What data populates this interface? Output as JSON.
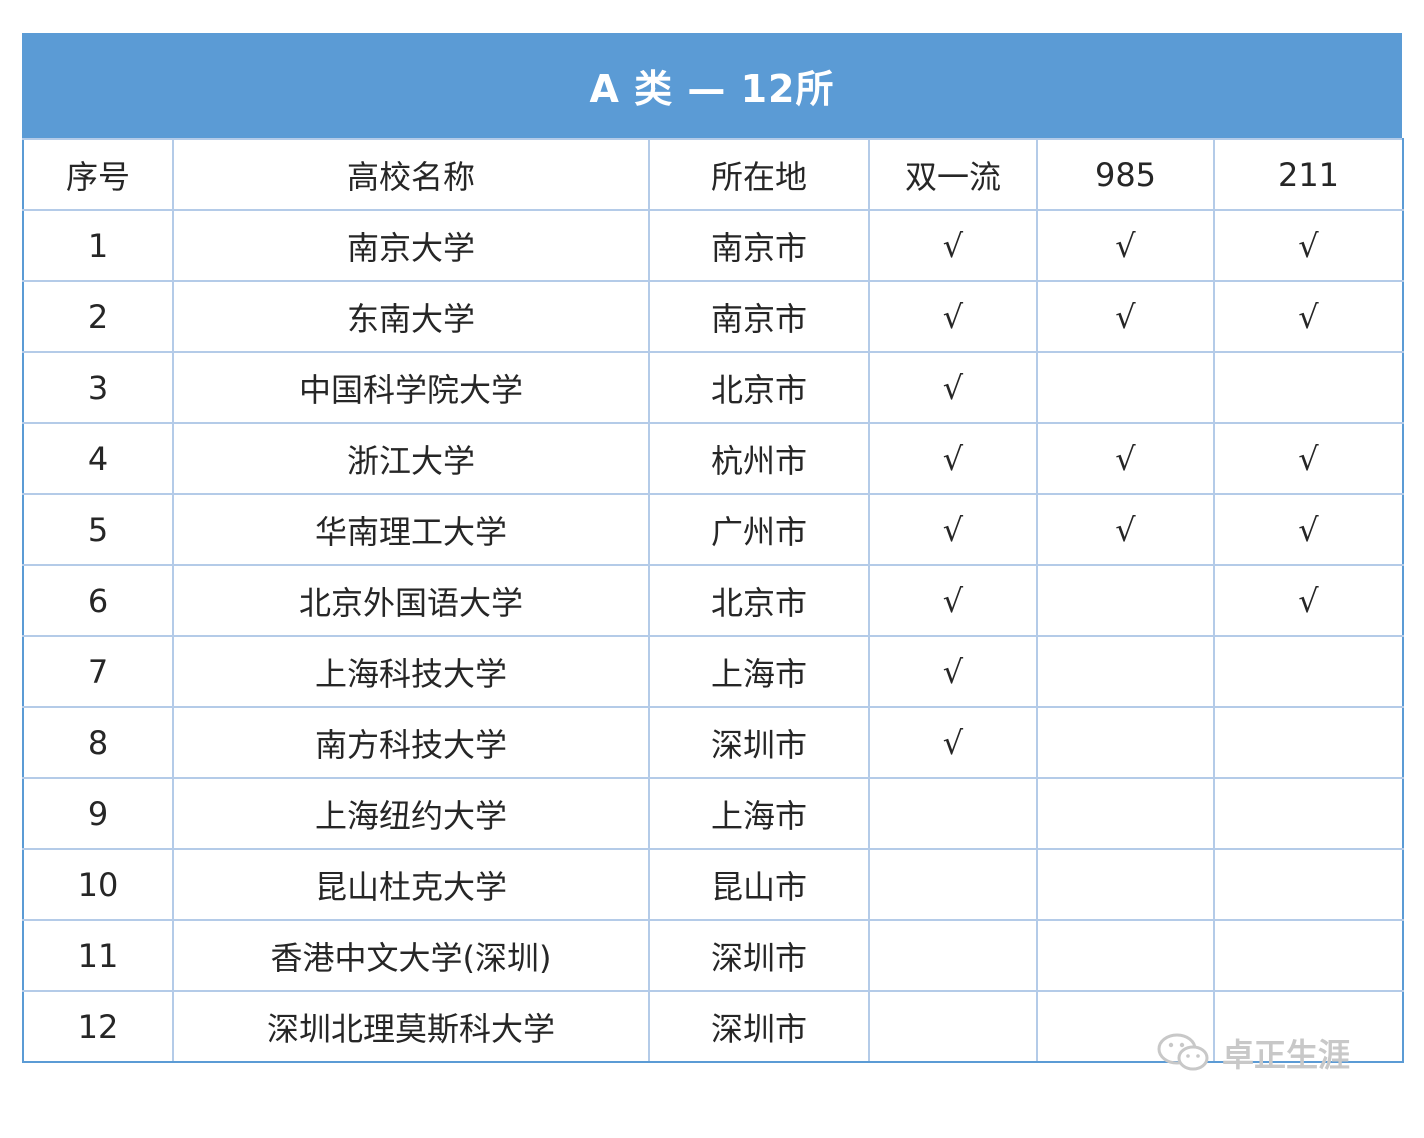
{
  "title": "A 类 — 12所",
  "columns": [
    "序号",
    "高校名称",
    "所在地",
    "双一流",
    "985",
    "211"
  ],
  "rows": [
    {
      "no": "1",
      "name": "南京大学",
      "city": "南京市",
      "dual": "√",
      "c985": "√",
      "c211": "√"
    },
    {
      "no": "2",
      "name": "东南大学",
      "city": "南京市",
      "dual": "√",
      "c985": "√",
      "c211": "√"
    },
    {
      "no": "3",
      "name": "中国科学院大学",
      "city": "北京市",
      "dual": "√",
      "c985": "",
      "c211": ""
    },
    {
      "no": "4",
      "name": "浙江大学",
      "city": "杭州市",
      "dual": "√",
      "c985": "√",
      "c211": "√"
    },
    {
      "no": "5",
      "name": "华南理工大学",
      "city": "广州市",
      "dual": "√",
      "c985": "√",
      "c211": "√"
    },
    {
      "no": "6",
      "name": "北京外国语大学",
      "city": "北京市",
      "dual": "√",
      "c985": "",
      "c211": "√"
    },
    {
      "no": "7",
      "name": "上海科技大学",
      "city": "上海市",
      "dual": "√",
      "c985": "",
      "c211": ""
    },
    {
      "no": "8",
      "name": "南方科技大学",
      "city": "深圳市",
      "dual": "√",
      "c985": "",
      "c211": ""
    },
    {
      "no": "9",
      "name": "上海纽约大学",
      "city": "上海市",
      "dual": "",
      "c985": "",
      "c211": ""
    },
    {
      "no": "10",
      "name": "昆山杜克大学",
      "city": "昆山市",
      "dual": "",
      "c985": "",
      "c211": ""
    },
    {
      "no": "11",
      "name": "香港中文大学(深圳)",
      "city": "深圳市",
      "dual": "",
      "c985": "",
      "c211": ""
    },
    {
      "no": "12",
      "name": "深圳北理莫斯科大学",
      "city": "深圳市",
      "dual": "",
      "c985": "",
      "c211": ""
    }
  ],
  "watermark": {
    "text": "卓正生涯",
    "icon": "wechat-icon"
  },
  "colors": {
    "header_bg": "#5b9bd5",
    "border": "#b4cbe8",
    "text": "#262626"
  }
}
